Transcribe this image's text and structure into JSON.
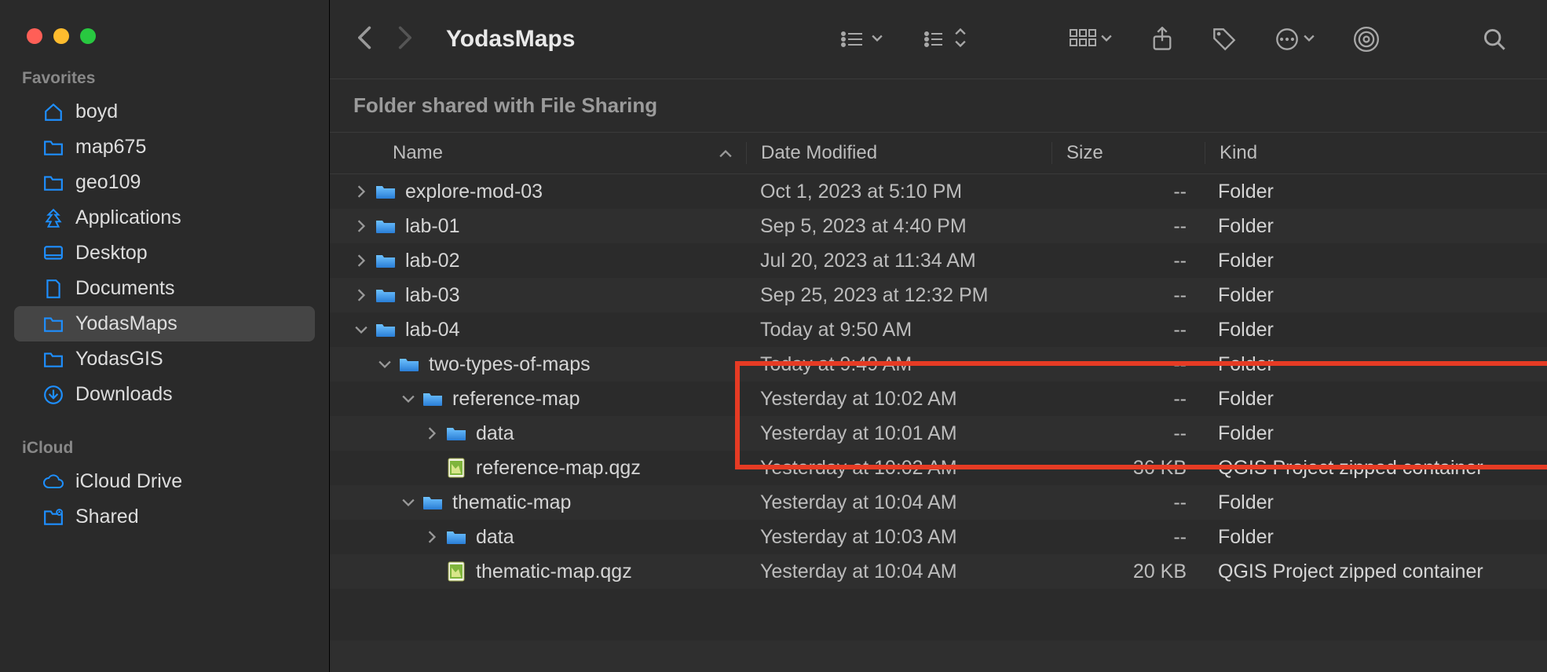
{
  "window": {
    "title": "YodasMaps",
    "banner": "Folder shared with File Sharing"
  },
  "sidebar": {
    "sections": [
      {
        "label": "Favorites",
        "items": [
          {
            "label": "boyd",
            "icon": "home"
          },
          {
            "label": "map675",
            "icon": "folder"
          },
          {
            "label": "geo109",
            "icon": "folder"
          },
          {
            "label": "Applications",
            "icon": "apps"
          },
          {
            "label": "Desktop",
            "icon": "desktop"
          },
          {
            "label": "Documents",
            "icon": "doc"
          },
          {
            "label": "YodasMaps",
            "icon": "folder",
            "selected": true
          },
          {
            "label": "YodasGIS",
            "icon": "folder"
          },
          {
            "label": "Downloads",
            "icon": "download"
          }
        ]
      },
      {
        "label": "iCloud",
        "items": [
          {
            "label": "iCloud Drive",
            "icon": "cloud"
          },
          {
            "label": "Shared",
            "icon": "shared-folder"
          }
        ]
      }
    ]
  },
  "columns": {
    "name": "Name",
    "date": "Date Modified",
    "size": "Size",
    "kind": "Kind"
  },
  "rows": [
    {
      "indent": 0,
      "disclosure": "right",
      "icon": "folder",
      "name": "explore-mod-03",
      "date": "Oct 1, 2023 at 5:10 PM",
      "size": "--",
      "kind": "Folder"
    },
    {
      "indent": 0,
      "disclosure": "right",
      "icon": "folder",
      "name": "lab-01",
      "date": "Sep 5, 2023 at 4:40 PM",
      "size": "--",
      "kind": "Folder"
    },
    {
      "indent": 0,
      "disclosure": "right",
      "icon": "folder",
      "name": "lab-02",
      "date": "Jul 20, 2023 at 11:34 AM",
      "size": "--",
      "kind": "Folder"
    },
    {
      "indent": 0,
      "disclosure": "right",
      "icon": "folder",
      "name": "lab-03",
      "date": "Sep 25, 2023 at 12:32 PM",
      "size": "--",
      "kind": "Folder"
    },
    {
      "indent": 0,
      "disclosure": "down",
      "icon": "folder",
      "name": "lab-04",
      "date": "Today at 9:50 AM",
      "size": "--",
      "kind": "Folder"
    },
    {
      "indent": 1,
      "disclosure": "down",
      "icon": "folder",
      "name": "two-types-of-maps",
      "date": "Today at 9:49 AM",
      "size": "--",
      "kind": "Folder"
    },
    {
      "indent": 2,
      "disclosure": "down",
      "icon": "folder",
      "name": "reference-map",
      "date": "Yesterday at 10:02 AM",
      "size": "--",
      "kind": "Folder"
    },
    {
      "indent": 3,
      "disclosure": "right",
      "icon": "folder",
      "name": "data",
      "date": "Yesterday at 10:01 AM",
      "size": "--",
      "kind": "Folder"
    },
    {
      "indent": 3,
      "disclosure": "none",
      "icon": "qgz",
      "name": "reference-map.qgz",
      "date": "Yesterday at 10:02 AM",
      "size": "36 KB",
      "kind": "QGIS Project zipped container"
    },
    {
      "indent": 2,
      "disclosure": "down",
      "icon": "folder",
      "name": "thematic-map",
      "date": "Yesterday at 10:04 AM",
      "size": "--",
      "kind": "Folder"
    },
    {
      "indent": 3,
      "disclosure": "right",
      "icon": "folder",
      "name": "data",
      "date": "Yesterday at 10:03 AM",
      "size": "--",
      "kind": "Folder"
    },
    {
      "indent": 3,
      "disclosure": "none",
      "icon": "qgz",
      "name": "thematic-map.qgz",
      "date": "Yesterday at 10:04 AM",
      "size": "20 KB",
      "kind": "QGIS Project zipped container"
    }
  ]
}
